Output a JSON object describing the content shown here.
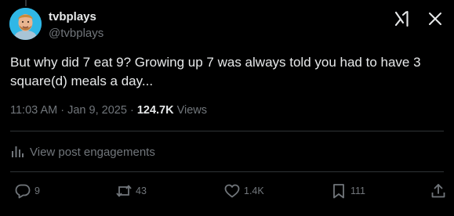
{
  "author": {
    "display_name": "tvbplays",
    "handle": "@tvbplays"
  },
  "tweet": {
    "text": "But why did 7 eat 9? Growing up 7 was always told you had to have 3 square(d) meals a day...",
    "time": "11:03 AM",
    "separator": "·",
    "date": "Jan 9, 2025",
    "views_count": "124.7K",
    "views_label": "Views"
  },
  "engagements": {
    "label": "View post engagements"
  },
  "actions": {
    "replies": "9",
    "reposts": "43",
    "likes": "1.4K",
    "bookmarks": "111"
  },
  "icons": {
    "top_right": [
      "grok-icon",
      "close-icon"
    ],
    "actions": [
      "reply-icon",
      "repost-icon",
      "like-icon",
      "bookmark-icon",
      "share-icon"
    ]
  },
  "colors": {
    "background": "#000000",
    "primary_text": "#e7e9ea",
    "secondary_text": "#71767b",
    "divider": "#2f3336",
    "avatar_bg": "#2fb7e6"
  }
}
